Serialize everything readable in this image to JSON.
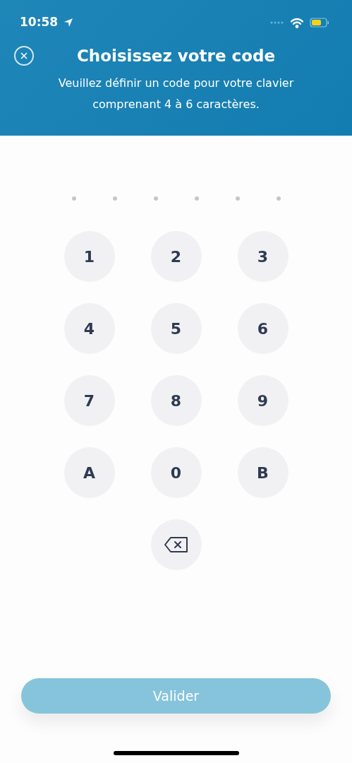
{
  "status_bar": {
    "time": "10:58"
  },
  "header": {
    "title": "Choisissez votre code",
    "subtitle": "Veuillez définir un code pour votre clavier comprenant 4 à 6 caractères."
  },
  "pin_slots": [
    {
      "filled": false
    },
    {
      "filled": false
    },
    {
      "filled": false
    },
    {
      "filled": false
    },
    {
      "filled": false
    },
    {
      "filled": false
    }
  ],
  "keypad": [
    {
      "kind": "digit",
      "label": "1"
    },
    {
      "kind": "digit",
      "label": "2"
    },
    {
      "kind": "digit",
      "label": "3"
    },
    {
      "kind": "digit",
      "label": "4"
    },
    {
      "kind": "digit",
      "label": "5"
    },
    {
      "kind": "digit",
      "label": "6"
    },
    {
      "kind": "digit",
      "label": "7"
    },
    {
      "kind": "digit",
      "label": "8"
    },
    {
      "kind": "digit",
      "label": "9"
    },
    {
      "kind": "digit",
      "label": "A"
    },
    {
      "kind": "digit",
      "label": "0"
    },
    {
      "kind": "digit",
      "label": "B"
    },
    {
      "kind": "backspace"
    }
  ],
  "submit": {
    "label": "Valider",
    "disabled": true
  }
}
